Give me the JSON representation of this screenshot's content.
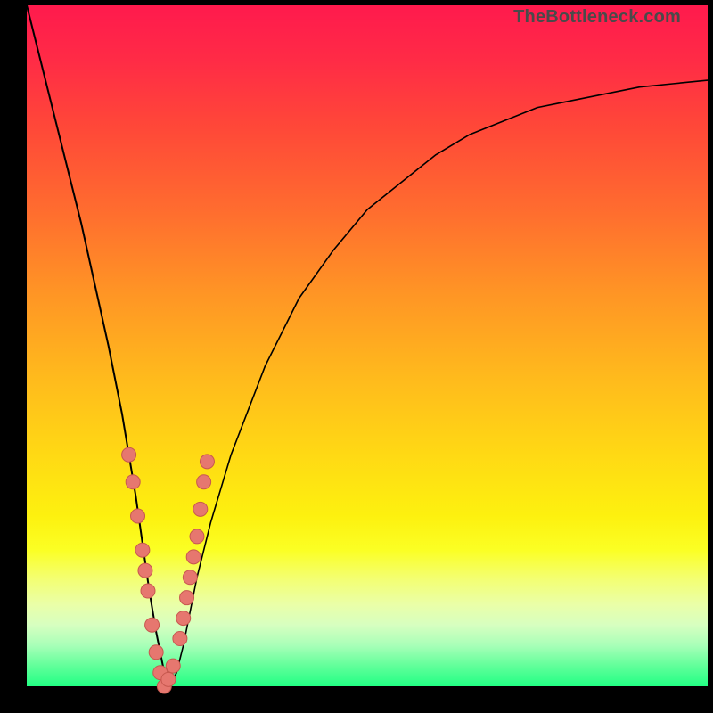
{
  "watermark": "TheBottleneck.com",
  "colors": {
    "curve": "#000000",
    "marker_fill": "#e6776f",
    "marker_stroke": "#c7584f",
    "frame": "#000000"
  },
  "chart_data": {
    "type": "line",
    "title": "",
    "xlabel": "",
    "ylabel": "",
    "xlim": [
      0,
      100
    ],
    "ylim": [
      0,
      100
    ],
    "grid": false,
    "legend": false,
    "annotations": [
      "TheBottleneck.com"
    ],
    "series": [
      {
        "name": "bottleneck-curve",
        "x": [
          0,
          2,
          4,
          6,
          8,
          10,
          12,
          14,
          15,
          16,
          17,
          18,
          19,
          20,
          21,
          22,
          23,
          24,
          25,
          27,
          30,
          35,
          40,
          45,
          50,
          55,
          60,
          65,
          70,
          75,
          80,
          85,
          90,
          95,
          100
        ],
        "y": [
          100,
          92,
          84,
          76,
          68,
          59,
          50,
          40,
          34,
          28,
          21,
          14,
          8,
          3,
          0,
          2,
          6,
          11,
          16,
          24,
          34,
          47,
          57,
          64,
          70,
          74,
          78,
          81,
          83,
          85,
          86,
          87,
          88,
          88.5,
          89
        ]
      }
    ],
    "markers": {
      "name": "highlight-cluster",
      "points": [
        {
          "x": 15.0,
          "y": 34
        },
        {
          "x": 15.6,
          "y": 30
        },
        {
          "x": 16.3,
          "y": 25
        },
        {
          "x": 17.0,
          "y": 20
        },
        {
          "x": 17.4,
          "y": 17
        },
        {
          "x": 17.8,
          "y": 14
        },
        {
          "x": 18.4,
          "y": 9
        },
        {
          "x": 19.0,
          "y": 5
        },
        {
          "x": 19.6,
          "y": 2
        },
        {
          "x": 20.2,
          "y": 0
        },
        {
          "x": 20.8,
          "y": 1
        },
        {
          "x": 21.5,
          "y": 3
        },
        {
          "x": 22.5,
          "y": 7
        },
        {
          "x": 23.0,
          "y": 10
        },
        {
          "x": 23.5,
          "y": 13
        },
        {
          "x": 24.0,
          "y": 16
        },
        {
          "x": 24.5,
          "y": 19
        },
        {
          "x": 25.0,
          "y": 22
        },
        {
          "x": 25.5,
          "y": 26
        },
        {
          "x": 26.0,
          "y": 30
        },
        {
          "x": 26.5,
          "y": 33
        }
      ]
    }
  }
}
